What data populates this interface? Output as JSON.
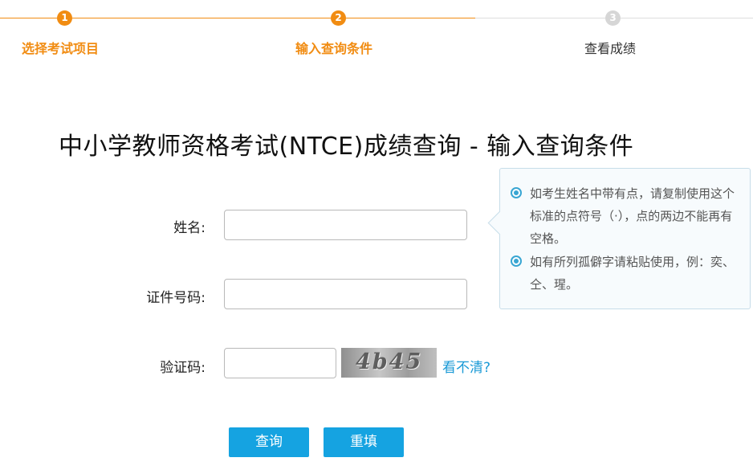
{
  "steps": [
    {
      "number": "1",
      "label": "选择考试项目",
      "state": "active"
    },
    {
      "number": "2",
      "label": "输入查询条件",
      "state": "active"
    },
    {
      "number": "3",
      "label": "查看成绩",
      "state": "inactive"
    }
  ],
  "page_title": "中小学教师资格考试(NTCE)成绩查询 - 输入查询条件",
  "form": {
    "name_label": "姓名:",
    "name_value": "",
    "id_label": "证件号码:",
    "id_value": "",
    "captcha_label": "验证码:",
    "captcha_value": "",
    "captcha_image_text": "4b45",
    "refresh_link": "看不清?"
  },
  "tips": [
    "如考生姓名中带有点，请复制使用这个标准的点符号（·），点的两边不能再有空格。",
    "如有所列孤僻字请粘贴使用，例：奕、仝、瑆。"
  ],
  "buttons": {
    "query": "查询",
    "reset": "重填"
  },
  "colors": {
    "active_step": "#f18c12",
    "inactive_step": "#d6d6d6",
    "button": "#15a3e1",
    "link": "#1b9ad6",
    "tip_icon": "#39a6d3"
  }
}
